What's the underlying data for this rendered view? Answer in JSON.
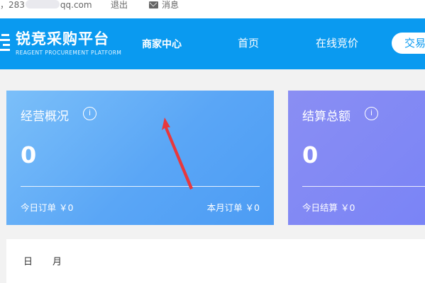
{
  "topbar": {
    "user_prefix": "，283",
    "user_suffix": "qq.com",
    "logout_label": "退出",
    "messages_label": "消息"
  },
  "nav": {
    "brand_name": "锐竞采购平台",
    "brand_subtitle": "REAGENT PROCUREMENT PLATFORM",
    "section_title": "商家中心",
    "home_label": "首页",
    "bidding_label": "在线竞价",
    "trade_label": "交易"
  },
  "cards": {
    "operations": {
      "title": "经营概况",
      "value": "0",
      "today_orders": "今日订单 ￥0",
      "month_orders": "本月订单 ￥0"
    },
    "settlement": {
      "title": "结算总额",
      "value": "0",
      "today_settlement": "今日结算 ￥0"
    }
  },
  "panel": {
    "tab_day": "日",
    "tab_month": "月"
  },
  "colors": {
    "nav_blue": "#0a9af0",
    "card_blue": "#5aa6f6",
    "card_purple": "#7a84f6",
    "arrow_red": "#e8383d"
  }
}
